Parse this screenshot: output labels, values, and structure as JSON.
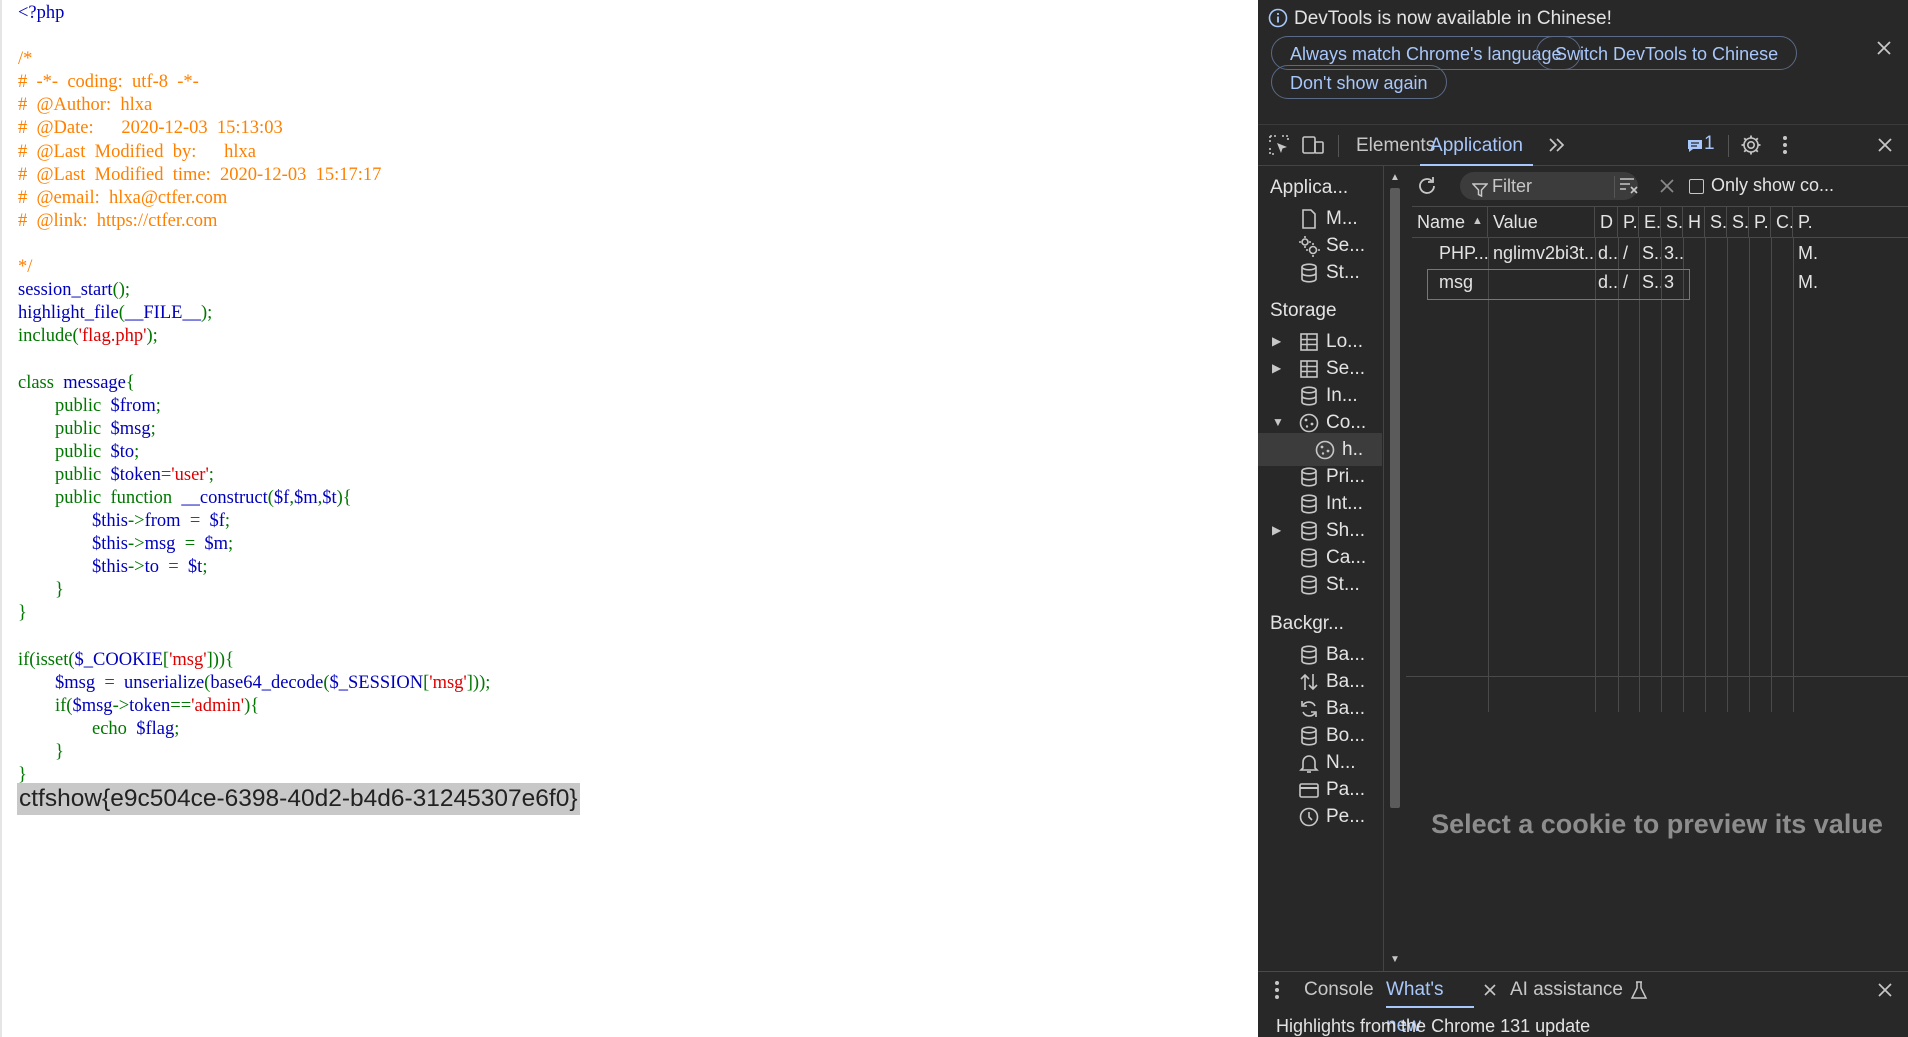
{
  "source": {
    "lines": [
      [
        [
          "h",
          "<?php"
        ]
      ],
      [],
      [
        [
          "c",
          "/*"
        ]
      ],
      [
        [
          "c",
          "#  -*-  coding:  utf-8  -*-"
        ]
      ],
      [
        [
          "c",
          "#  @Author:  hlxa"
        ]
      ],
      [
        [
          "c",
          "#  @Date:      2020-12-03  15:13:03"
        ]
      ],
      [
        [
          "c",
          "#  @Last  Modified  by:      hlxa"
        ]
      ],
      [
        [
          "c",
          "#  @Last  Modified  time:  2020-12-03  15:17:17"
        ]
      ],
      [
        [
          "c",
          "#  @email:  hlxa@ctfer.com"
        ]
      ],
      [
        [
          "c",
          "#  @link:  https://ctfer.com"
        ]
      ],
      [],
      [
        [
          "c",
          "*/"
        ]
      ],
      [
        [
          "v",
          "session_start"
        ],
        [
          "k",
          "();"
        ]
      ],
      [
        [
          "v",
          "highlight_file"
        ],
        [
          "k",
          "("
        ],
        [
          "v",
          "__FILE__"
        ],
        [
          "k",
          ");"
        ]
      ],
      [
        [
          "k",
          "include("
        ],
        [
          "s",
          "'flag.php'"
        ],
        [
          "k",
          ");"
        ]
      ],
      [],
      [
        [
          "k",
          "class  "
        ],
        [
          "v",
          "message"
        ],
        [
          "k",
          "{"
        ]
      ],
      [
        [
          "k",
          "        public  "
        ],
        [
          "v",
          "$from"
        ],
        [
          "k",
          ";"
        ]
      ],
      [
        [
          "k",
          "        public  "
        ],
        [
          "v",
          "$msg"
        ],
        [
          "k",
          ";"
        ]
      ],
      [
        [
          "k",
          "        public  "
        ],
        [
          "v",
          "$to"
        ],
        [
          "k",
          ";"
        ]
      ],
      [
        [
          "k",
          "        public  "
        ],
        [
          "v",
          "$token"
        ],
        [
          "k",
          "="
        ],
        [
          "s",
          "'user'"
        ],
        [
          "k",
          ";"
        ]
      ],
      [
        [
          "k",
          "        public  function  "
        ],
        [
          "v",
          "__construct"
        ],
        [
          "k",
          "("
        ],
        [
          "v",
          "$f"
        ],
        [
          "k",
          ","
        ],
        [
          "v",
          "$m"
        ],
        [
          "k",
          ","
        ],
        [
          "v",
          "$t"
        ],
        [
          "k",
          "){"
        ]
      ],
      [
        [
          "k",
          "                "
        ],
        [
          "v",
          "$this"
        ],
        [
          "k",
          "->"
        ],
        [
          "v",
          "from  "
        ],
        [
          "k",
          "=  "
        ],
        [
          "v",
          "$f"
        ],
        [
          "k",
          ";"
        ]
      ],
      [
        [
          "k",
          "                "
        ],
        [
          "v",
          "$this"
        ],
        [
          "k",
          "->"
        ],
        [
          "v",
          "msg  "
        ],
        [
          "k",
          "=  "
        ],
        [
          "v",
          "$m"
        ],
        [
          "k",
          ";"
        ]
      ],
      [
        [
          "k",
          "                "
        ],
        [
          "v",
          "$this"
        ],
        [
          "k",
          "->"
        ],
        [
          "v",
          "to  "
        ],
        [
          "k",
          "=  "
        ],
        [
          "v",
          "$t"
        ],
        [
          "k",
          ";"
        ]
      ],
      [
        [
          "k",
          "        }"
        ]
      ],
      [
        [
          "k",
          "}"
        ]
      ],
      [],
      [
        [
          "k",
          "if(isset("
        ],
        [
          "v",
          "$_COOKIE"
        ],
        [
          "k",
          "["
        ],
        [
          "s",
          "'msg'"
        ],
        [
          "k",
          "])){"
        ]
      ],
      [
        [
          "k",
          "        "
        ],
        [
          "v",
          "$msg  "
        ],
        [
          "k",
          "=  "
        ],
        [
          "v",
          "unserialize"
        ],
        [
          "k",
          "("
        ],
        [
          "v",
          "base64_decode"
        ],
        [
          "k",
          "("
        ],
        [
          "v",
          "$_SESSION"
        ],
        [
          "k",
          "["
        ],
        [
          "s",
          "'msg'"
        ],
        [
          "k",
          "]));"
        ]
      ],
      [
        [
          "k",
          "        if("
        ],
        [
          "v",
          "$msg"
        ],
        [
          "k",
          "->"
        ],
        [
          "v",
          "token"
        ],
        [
          "k",
          "=="
        ],
        [
          "s",
          "'admin'"
        ],
        [
          "k",
          "){"
        ]
      ],
      [
        [
          "k",
          "                echo  "
        ],
        [
          "v",
          "$flag"
        ],
        [
          "k",
          ";"
        ]
      ],
      [
        [
          "k",
          "        }"
        ]
      ],
      [
        [
          "k",
          "}"
        ]
      ]
    ],
    "flag_output": "ctfshow{e9c504ce-6398-40d2-b4d6-31245307e6f0}"
  },
  "devtools": {
    "infobar": {
      "message": "DevTools is now available in Chinese!",
      "btn_match": "Always match Chrome's language",
      "btn_switch": "Switch DevTools to Chinese",
      "btn_dont_show": "Don't show again"
    },
    "tabs": {
      "elements": "Elements",
      "application": "Application",
      "issues_count": "1"
    },
    "sidebar": {
      "app_header": "Applica...",
      "app_items": [
        {
          "label": "M..."
        },
        {
          "label": "Se..."
        },
        {
          "label": "St..."
        }
      ],
      "storage_header": "Storage",
      "storage_items": [
        {
          "label": "Lo..."
        },
        {
          "label": "Se..."
        },
        {
          "label": "In..."
        },
        {
          "label": "Co..."
        },
        {
          "label": "h.."
        },
        {
          "label": "Pri..."
        },
        {
          "label": "Int..."
        },
        {
          "label": "Sh..."
        },
        {
          "label": "Ca..."
        },
        {
          "label": "St..."
        }
      ],
      "bg_header": "Backgr...",
      "bg_items": [
        {
          "label": "Ba..."
        },
        {
          "label": "Ba..."
        },
        {
          "label": "Ba..."
        },
        {
          "label": "Bo..."
        },
        {
          "label": "N..."
        },
        {
          "label": "Pa..."
        },
        {
          "label": "Pe..."
        }
      ]
    },
    "cookies": {
      "filter_placeholder": "Filter",
      "only_show": "Only show co...",
      "columns": [
        "Name",
        "Value",
        "D",
        "P.",
        "E.",
        "S.",
        "H",
        "S.",
        "S.",
        "P.",
        "C.",
        "P."
      ],
      "rows": [
        {
          "name": "PHP...",
          "value": "nglimv2bi3t...",
          "domain": "d..",
          "path": "/",
          "expires": "S..",
          "size": "3..",
          "priority": "M."
        },
        {
          "name": "msg",
          "value": "",
          "domain": "d..",
          "path": "/",
          "expires": "S..",
          "size": "3",
          "priority": "M."
        }
      ],
      "preview_text": "Select a cookie to preview its value"
    },
    "drawer": {
      "console": "Console",
      "whats_new": "What's new",
      "ai": "AI assistance",
      "content": "Highlights from the Chrome 131 update"
    },
    "colors": {
      "accent": "#a8c7fa",
      "panel_bg": "#282828",
      "highlight_box": "#e04a4a"
    }
  }
}
